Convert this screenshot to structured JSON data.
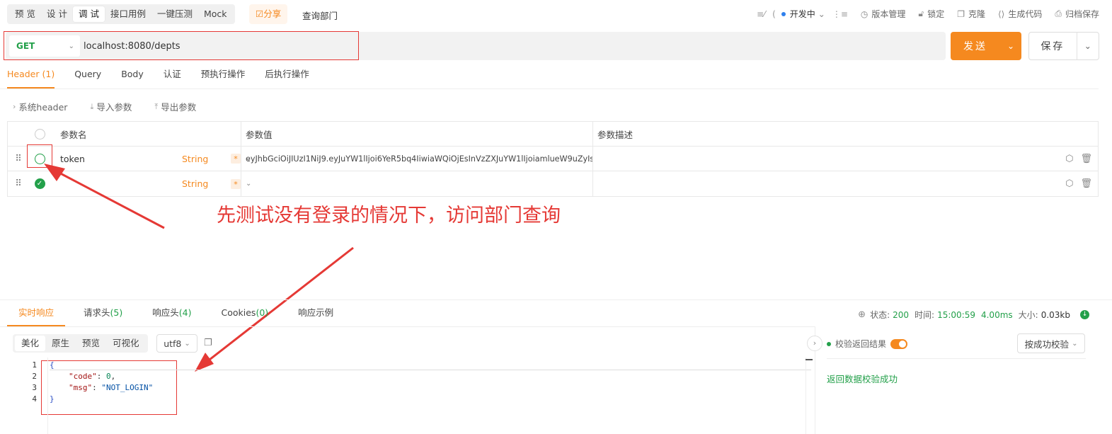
{
  "toolbar": {
    "mode_tabs": [
      "预 览",
      "设 计",
      "调 试",
      "接口用例",
      "一键压测",
      "Mock"
    ],
    "share_label": "☑分享",
    "api_title": "查询部门",
    "env_label": "开发中",
    "tools": [
      "版本管理",
      "锁定",
      "克隆",
      "生成代码",
      "归档保存"
    ]
  },
  "request": {
    "method": "GET",
    "url": "localhost:8080/depts",
    "send_label": "发送",
    "save_label": "保存"
  },
  "request_tabs": [
    "Header (1)",
    "Query",
    "Body",
    "认证",
    "预执行操作",
    "后执行操作"
  ],
  "header_tools": [
    "系统header",
    "导入参数",
    "导出参数"
  ],
  "params": {
    "columns": [
      "参数名",
      "参数值",
      "参数描述"
    ],
    "rows": [
      {
        "name": "token",
        "type": "String",
        "required": "*",
        "value": "eyJhbGciOiJIUzI1NiJ9.eyJuYW1lIjoi6YeR5bq4IiwiaWQiOjEsInVzZXJuYW1lIjoiamlueW9uZyIsI",
        "desc": ""
      },
      {
        "name": "",
        "type": "String",
        "required": "*",
        "value": "",
        "desc": ""
      }
    ]
  },
  "annotation": {
    "text": "先测试没有登录的情况下，访问部门查询",
    "color": "#e53935"
  },
  "response": {
    "tabs": [
      {
        "label": "实时响应",
        "count": ""
      },
      {
        "label": "请求头",
        "count": "(5)"
      },
      {
        "label": "响应头",
        "count": "(4)"
      },
      {
        "label": "Cookies",
        "count": "(0)"
      },
      {
        "label": "响应示例",
        "count": ""
      }
    ],
    "status_label": "状态:",
    "status": "200",
    "time_label": "时间:",
    "time": "15:00:59",
    "duration": "4.00ms",
    "size_label": "大小:",
    "size": "0.03kb",
    "format_tabs": [
      "美化",
      "原生",
      "预览",
      "可视化"
    ],
    "encoding": "utf8",
    "code": {
      "line_numbers": [
        "1",
        "2",
        "3",
        "4"
      ],
      "open": "{",
      "k1": "\"code\"",
      "v1": "0",
      "k2": "\"msg\"",
      "v2": "\"NOT_LOGIN\"",
      "close": "}"
    },
    "verify_label": "校验返回结果",
    "verify_mode": "按成功校验",
    "verify_result": "返回数据校验成功"
  },
  "colors": {
    "accent": "#f5891f",
    "success": "#23a04a",
    "annotation": "#e53935"
  }
}
